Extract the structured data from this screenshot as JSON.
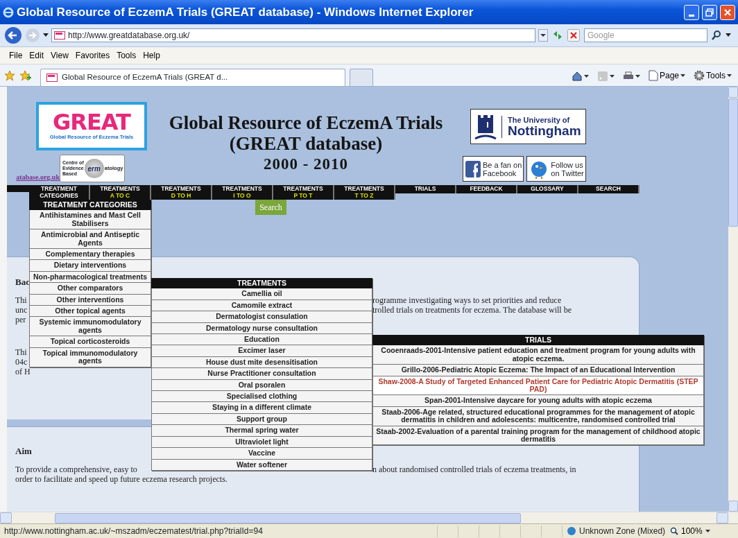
{
  "window": {
    "title": "Global Resource of EczemA Trials (GREAT database) - Windows Internet Explorer"
  },
  "address_bar": {
    "url": "http://www.greatdatabase.org.uk/",
    "search_placeholder": "Google"
  },
  "menu_bar": [
    "File",
    "Edit",
    "View",
    "Favorites",
    "Tools",
    "Help"
  ],
  "tabs": [
    {
      "label": "Global Resource of EczemA Trials (GREAT d...",
      "selected": true
    }
  ],
  "command_bar": {
    "page": "Page",
    "tools": "Tools"
  },
  "page": {
    "logo": {
      "title": "GREAT",
      "subtitle": "Global Resource of Eczema Trials"
    },
    "site_link": "atabase.org.uk",
    "derm_logo": {
      "lines": [
        "Centre of",
        "Evidence",
        "Based"
      ],
      "lens": "erm",
      "rest": "atology"
    },
    "title_lines": [
      "Global Resource of EczemA Trials",
      "(GREAT database)",
      "2000 - 2010"
    ],
    "university_logo": {
      "line1": "The University of",
      "line2": "Nottingham"
    },
    "social": [
      {
        "kind": "facebook",
        "lines": [
          "Be a fan on",
          "Facebook"
        ]
      },
      {
        "kind": "twitter",
        "lines": [
          "Follow us",
          "on Twitter"
        ]
      }
    ],
    "nav": [
      {
        "lines": [
          "TREATMENT",
          "CATEGORIES"
        ]
      },
      {
        "label": "TREATMENTS",
        "range": "A TO C"
      },
      {
        "label": "TREATMENTS",
        "range": "D TO H"
      },
      {
        "label": "TREATMENTS",
        "range": "I TO O"
      },
      {
        "label": "TREATMENTS",
        "range": "P TO T"
      },
      {
        "label": "TREATMENTS",
        "range": "T TO Z"
      },
      {
        "label": "TRIALS"
      },
      {
        "label": "FEEDBACK"
      },
      {
        "label": "GLOSSARY"
      },
      {
        "label": "SEARCH"
      }
    ],
    "search_button": "Search",
    "background": {
      "heading": "Bac",
      "lines": [
        {
          "left": "Thi",
          "right": "rogramme investigating ways to set priorities and reduce"
        },
        {
          "left": "unc",
          "right_before": "trolled trials on treatments for ",
          "right_link": "eczema",
          "right_after": ". The database will be"
        },
        {
          "left": "per"
        }
      ],
      "lines2": [
        {
          "left": "Thi"
        },
        {
          "left": "04c"
        },
        {
          "left": "of H"
        }
      ]
    },
    "aim": {
      "heading": "Aim",
      "lines": [
        {
          "left": "To provide a comprehensive, easy to",
          "right": "n about randomised controlled trials of eczema treatments, in"
        },
        {
          "left": "order to facilitate and speed up future eczema research projects."
        }
      ]
    }
  },
  "menus": {
    "categories": {
      "heading": "TREATMENT CATEGORIES",
      "items": [
        "Antihistamines and Mast Cell Stabilisers",
        "Antimicrobial and Antiseptic Agents",
        "Complementary therapies",
        "Dietary interventions",
        "Non-pharmacological treatments",
        "Other comparators",
        "Other interventions",
        "Other topical agents",
        "Systemic immunomodulatory agents",
        "Topical corticosteroids",
        "Topical immunomodulatory agents"
      ]
    },
    "treatments": {
      "heading": "TREATMENTS",
      "items": [
        "Camellia oil",
        "Camomile extract",
        "Dermatologist consulation",
        "Dermatology nurse consultation",
        "Education",
        "Excimer laser",
        "House dust mite desensitisation",
        "Nurse Practitioner consultation",
        "Oral psoralen",
        "Specialised clothing",
        "Staying in a different climate",
        "Support group",
        "Thermal spring water",
        "Ultraviolet light",
        "Vaccine",
        "Water softener"
      ]
    },
    "trials": {
      "heading": "TRIALS",
      "items": [
        {
          "label": "Cooenraads-2001-Intensive patient education and treatment program for young adults with atopic eczema.",
          "selected": false
        },
        {
          "label": "Grillo-2006-Pediatric Atopic Eczema: The Impact of an Educational Intervention",
          "selected": false
        },
        {
          "label": "Shaw-2008-A Study of Targeted Enhanced Patient Care for Pediatric Atopic Dermatitis (STEP PAD)",
          "selected": true
        },
        {
          "label": "Span-2001-Intensive daycare for young adults with atopic eczema",
          "selected": false
        },
        {
          "label": "Staab-2006-Age related, structured educational programmes for the management of atopic dermatitis in children and adolescents: multicentre, randomised controlled trial",
          "selected": false
        },
        {
          "label": "Staab-2002-Evaluation of a parental training program for the management of childhood atopic dermatitis",
          "selected": false
        }
      ]
    }
  },
  "status_bar": {
    "url": "http://www.nottingham.ac.uk/~mszadm/eczematest/trial.php?trialId=94",
    "zone": "Unknown Zone (Mixed)",
    "zoom": "100%"
  }
}
